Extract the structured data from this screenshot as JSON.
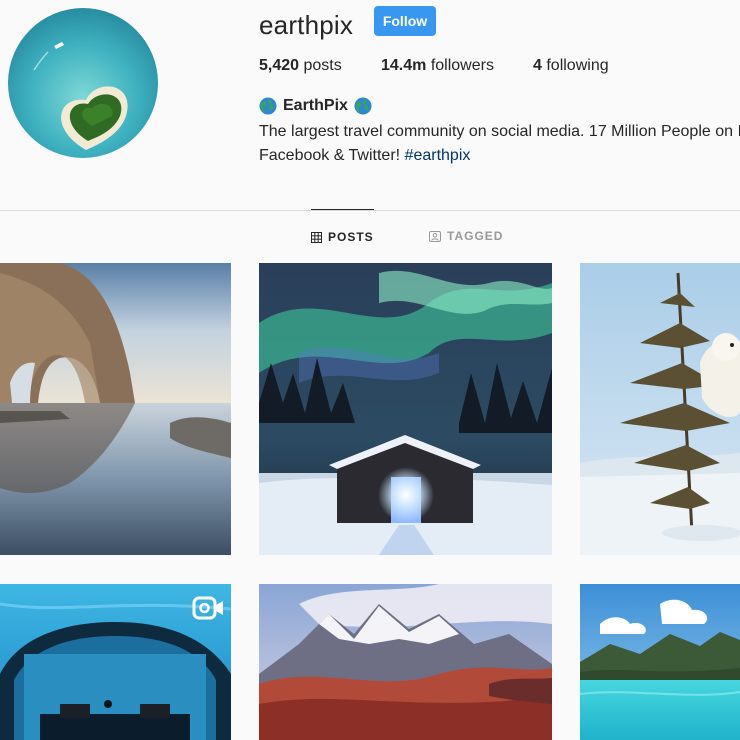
{
  "profile": {
    "username": "earthpix",
    "follow_label": "Follow",
    "full_name": "EarthPix",
    "name_emoji": "globe-emoji",
    "bio_line1": "The largest travel community on social media. 17 Million People on I",
    "bio_line2_prefix": "Facebook & Twitter! ",
    "bio_hashtag": "#earthpix"
  },
  "stats": {
    "posts_count": "5,420",
    "posts_label": " posts",
    "followers_count": "14.4m",
    "followers_label": " followers",
    "following_count": "4",
    "following_label": " following"
  },
  "tabs": [
    {
      "label": "POSTS",
      "icon": "grid-icon",
      "active": true
    },
    {
      "label": "TAGGED",
      "icon": "tag-icon",
      "active": false
    }
  ],
  "posts": [
    {
      "subject": "sea-arch-rock",
      "video": false
    },
    {
      "subject": "aurora-cabin",
      "video": false
    },
    {
      "subject": "polar-bear-tree",
      "video": false
    },
    {
      "subject": "underwater-room",
      "video": true
    },
    {
      "subject": "mountain-autumn",
      "video": false
    },
    {
      "subject": "turquoise-lagoon",
      "video": false
    }
  ],
  "colors": {
    "follow_button": "#3897f0",
    "hashtag": "#003569",
    "text": "#262626",
    "muted": "#999999",
    "background": "#fafafa"
  }
}
